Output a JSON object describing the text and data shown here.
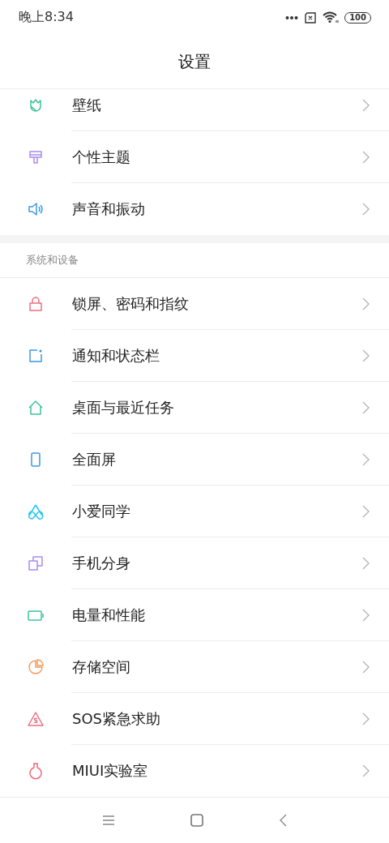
{
  "status_bar": {
    "time": "晚上8:34",
    "battery": "100"
  },
  "title": "设置",
  "groups": [
    {
      "items": [
        {
          "label": "壁纸"
        },
        {
          "label": "个性主题"
        },
        {
          "label": "声音和振动"
        }
      ]
    },
    {
      "header": "系统和设备",
      "items": [
        {
          "label": "锁屏、密码和指纹"
        },
        {
          "label": "通知和状态栏"
        },
        {
          "label": "桌面与最近任务"
        },
        {
          "label": "全面屏"
        },
        {
          "label": "小爱同学"
        },
        {
          "label": "手机分身"
        },
        {
          "label": "电量和性能"
        },
        {
          "label": "存储空间"
        },
        {
          "label": "SOS紧急求助"
        },
        {
          "label": "MIUI实验室"
        }
      ]
    }
  ]
}
